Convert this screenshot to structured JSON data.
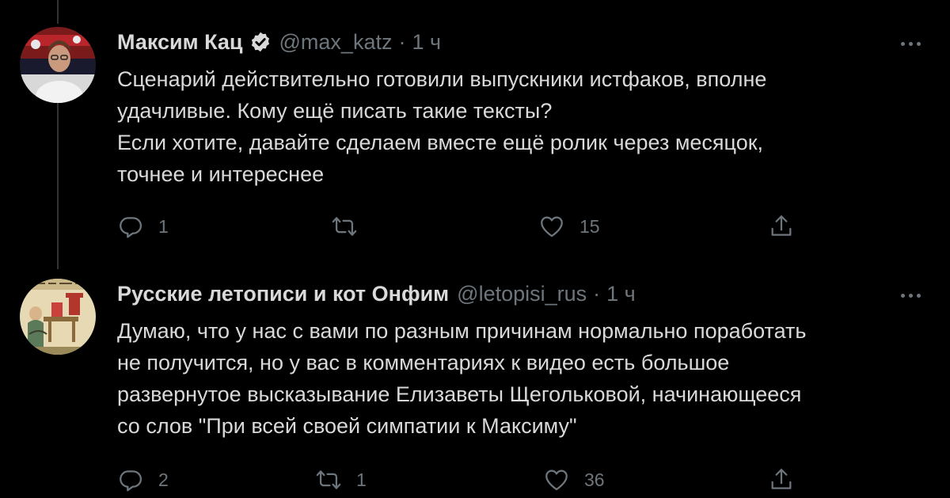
{
  "tweets": [
    {
      "name": "Максим Кац",
      "verified": true,
      "handle": "@max_katz",
      "separator": "·",
      "time": "1 ч",
      "lines": [
        "Сценарий действительно готовили выпускники истфаков, вполне",
        "удачливые. Кому ещё писать такие тексты?",
        "Если хотите, давайте сделаем вместе ещё ролик через месяцок,",
        "точнее и интереснее"
      ],
      "replies": "1",
      "retweets": "",
      "likes": "15"
    },
    {
      "name": "Русские летописи и кот Онфим",
      "verified": false,
      "handle": "@letopisi_rus",
      "separator": "·",
      "time": "1 ч",
      "lines": [
        "Думаю, что у нас с вами по разным причинам нормально поработать",
        "не получится, но у вас в комментариях к видео есть большое",
        "развернутое высказывание Елизаветы Щегольковой, начинающееся",
        "со слов \"При всей своей симпатии к Максиму\""
      ],
      "replies": "2",
      "retweets": "1",
      "likes": "36"
    }
  ],
  "icons": {
    "reply": "reply-icon",
    "retweet": "retweet-icon",
    "like": "heart-icon",
    "share": "share-icon",
    "more": "more-icon",
    "verified": "verified-badge-icon"
  },
  "colors": {
    "background": "#000000",
    "text": "#D9D9D9",
    "muted": "#6E767D",
    "divider": "#2F3336"
  }
}
